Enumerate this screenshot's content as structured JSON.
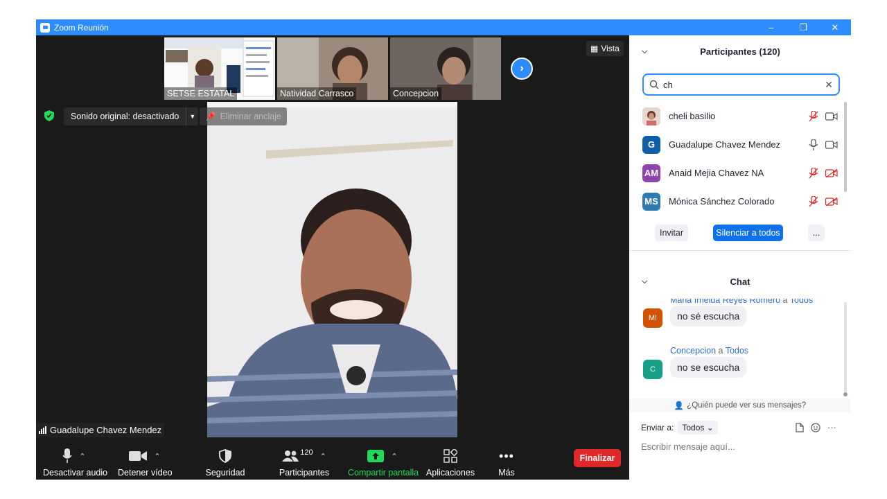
{
  "window": {
    "title": "Zoom Reunión",
    "controls": [
      "–",
      "❐",
      "✕"
    ]
  },
  "gallery": {
    "thumbs": [
      {
        "name": "SETSE ESTATAL"
      },
      {
        "name": "Natividad Carrasco"
      },
      {
        "name": "Concepcion"
      }
    ],
    "next_icon": "chevron-right-icon",
    "view_label": "Vista"
  },
  "stage": {
    "original_sound": "Sonido original: desactivado",
    "unpin_label": "Eliminar anclaje",
    "speaker_name": "Guadalupe Chavez Mendez"
  },
  "toolbar": {
    "mute": "Desactivar audio",
    "video": "Detener vídeo",
    "security": "Seguridad",
    "participants": "Participantes",
    "participants_count": "120",
    "share": "Compartir pantalla",
    "apps": "Aplicaciones",
    "more": "Más",
    "end": "Finalizar"
  },
  "participants_panel": {
    "title": "Participantes (120)",
    "search_value": "ch",
    "rows": [
      {
        "initials": "",
        "name": "cheli basilio",
        "color": "#b07a6a",
        "mic": "muted",
        "cam": "on"
      },
      {
        "initials": "G",
        "name": "Guadalupe Chavez Mendez",
        "color": "#0e5fa8",
        "mic": "on",
        "cam": "on"
      },
      {
        "initials": "AM",
        "name": "Anaid Mejia Chavez NA",
        "color": "#8e44ad",
        "mic": "muted",
        "cam": "off"
      },
      {
        "initials": "MS",
        "name": "Mónica Sánchez Colorado",
        "color": "#2e7bb4",
        "mic": "muted",
        "cam": "off"
      }
    ],
    "invite": "Invitar",
    "mute_all": "Silenciar a todos",
    "more": "..."
  },
  "chat": {
    "title": "Chat",
    "messages": [
      {
        "initials": "MI",
        "color": "#d35400",
        "from": "Maria Imelda Reyes Romero",
        "to_word": "a",
        "to": "Todos",
        "text": "no sé  escucha"
      },
      {
        "initials": "C",
        "color": "#16a085",
        "from": "Concepcion",
        "to_word": "a",
        "to": "Todos",
        "text": "no se escucha"
      }
    ],
    "who_can_see": "¿Quién puede ver sus mensajes?",
    "send_to_label": "Enviar a:",
    "send_to_value": "Todos",
    "compose_placeholder": "Escribir mensaje aquí...",
    "more_icon": "···"
  },
  "colors": {
    "accent": "#2d8cff",
    "end": "#e02828",
    "share": "#23d959"
  }
}
